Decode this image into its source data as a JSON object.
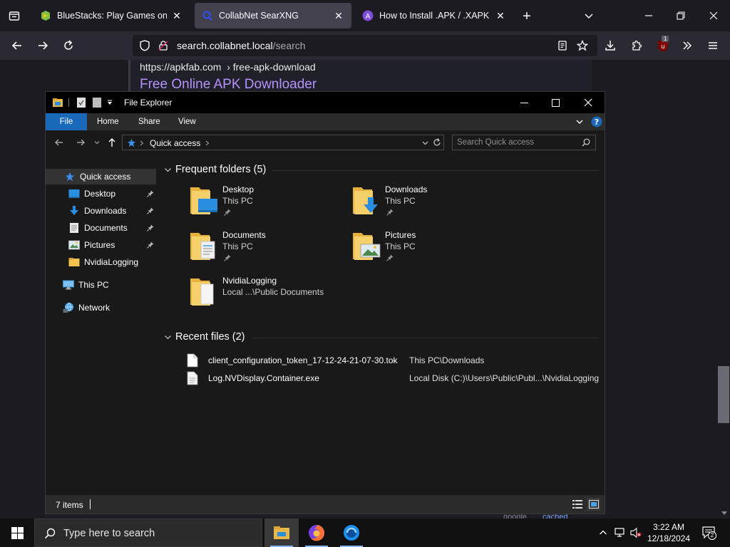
{
  "browser": {
    "tabs": [
      {
        "title": "BlueStacks: Play Games on PC /",
        "active": false
      },
      {
        "title": "CollabNet SearXNG",
        "active": true
      },
      {
        "title": "How to Install .APK / .XAPK on",
        "active": false
      }
    ],
    "url": {
      "host": "search.collabnet.local",
      "path": "/search"
    },
    "extension_badge": "1"
  },
  "page": {
    "result_url": "https://apkfab.com",
    "result_path": "› free-apk-download",
    "result_title": "Free Online APK Downloader",
    "footer_partial": "google",
    "footer_link": "cached"
  },
  "explorer": {
    "title": "File Explorer",
    "ribbon_tabs": [
      "File",
      "Home",
      "Share",
      "View"
    ],
    "address": "Quick access",
    "search_placeholder": "Search Quick access",
    "nav": {
      "quick_access": "Quick access",
      "pinned": [
        {
          "label": "Desktop",
          "pinned": true
        },
        {
          "label": "Downloads",
          "pinned": true
        },
        {
          "label": "Documents",
          "pinned": true
        },
        {
          "label": "Pictures",
          "pinned": true
        },
        {
          "label": "NvidiaLogging",
          "pinned": false
        }
      ],
      "this_pc": "This PC",
      "network": "Network"
    },
    "frequent_header": "Frequent folders (5)",
    "frequent": [
      {
        "name": "Desktop",
        "location": "This PC",
        "pinned": true
      },
      {
        "name": "Downloads",
        "location": "This PC",
        "pinned": true
      },
      {
        "name": "Documents",
        "location": "This PC",
        "pinned": true
      },
      {
        "name": "Pictures",
        "location": "This PC",
        "pinned": true
      },
      {
        "name": "NvidiaLogging",
        "location": "Local ...\\Public Documents",
        "pinned": false
      }
    ],
    "recent_header": "Recent files (2)",
    "recent": [
      {
        "name": "client_configuration_token_17-12-24-21-07-30.tok",
        "location": "This PC\\Downloads"
      },
      {
        "name": "Log.NVDisplay.Container.exe",
        "location": "Local Disk (C:)\\Users\\Public\\Publ...\\NvidiaLogging"
      }
    ],
    "status": "7 items"
  },
  "taskbar": {
    "search_placeholder": "Type here to search",
    "time": "3:22 AM",
    "date": "12/18/2024",
    "notifications": "2"
  }
}
